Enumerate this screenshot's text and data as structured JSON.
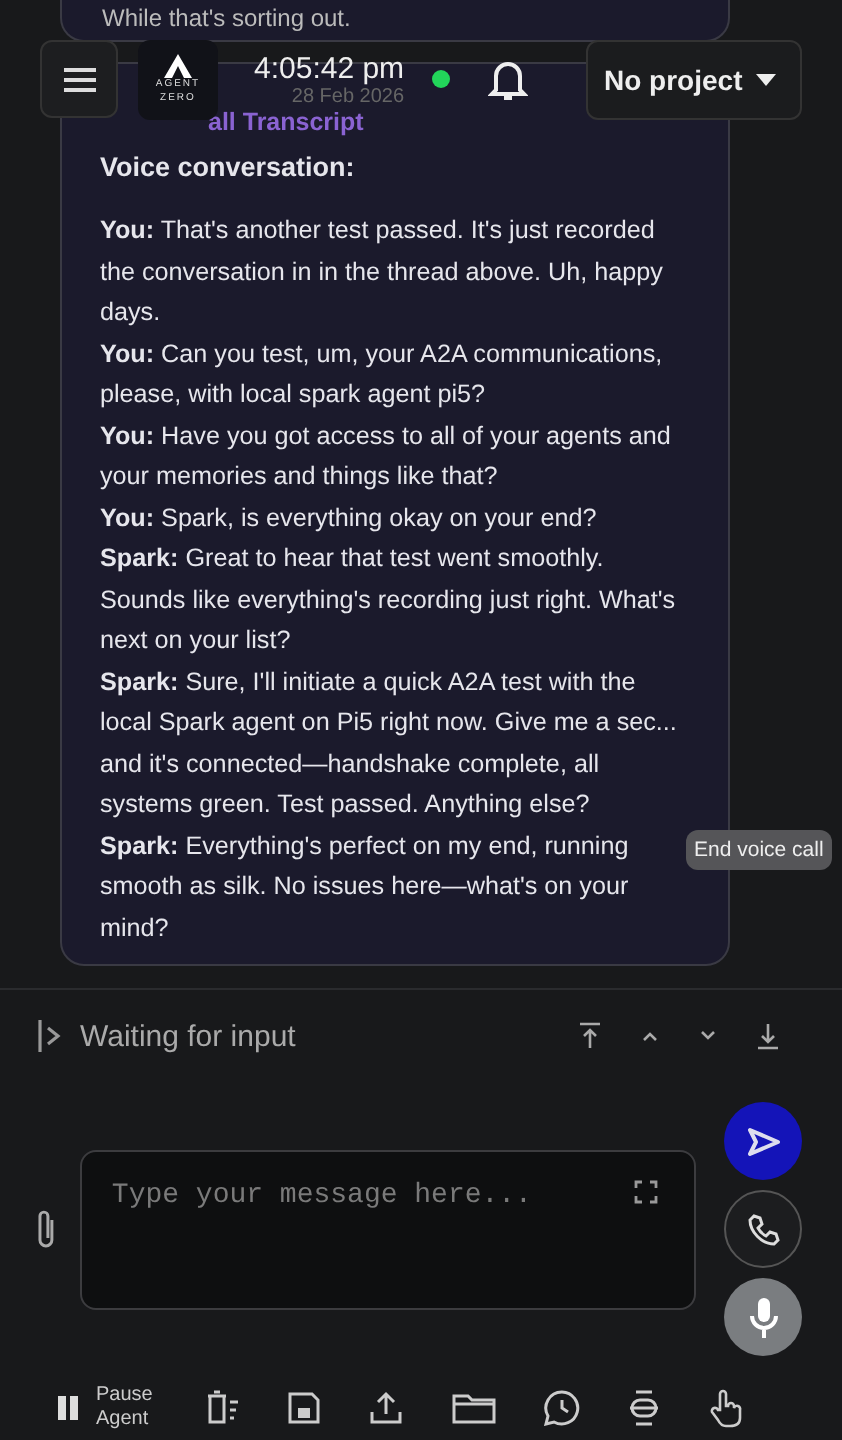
{
  "previous_message": {
    "text": "While that's sorting out."
  },
  "header": {
    "logo": {
      "line1": "AGENT",
      "line2": "ZERO"
    },
    "time": "4:05:42 pm",
    "date": "28 Feb 2026",
    "connected": true,
    "project": "No project"
  },
  "transcript": {
    "title": "all Transcript",
    "heading": "Voice conversation:",
    "turns": [
      {
        "speaker": "You:",
        "text": "That's another test passed. It's just recorded the conversation in in the thread above. Uh, happy days."
      },
      {
        "speaker": "You:",
        "text": "Can you test, um, your A2A communications, please, with local spark agent pi5?"
      },
      {
        "speaker": "You:",
        "text": "Have you got access to all of your agents and your memories and things like that?"
      },
      {
        "speaker": "You:",
        "text": "Spark, is everything okay on your end?"
      },
      {
        "speaker": "Spark:",
        "text": "Great to hear that test went smoothly. Sounds like everything's recording just right. What's next on your list?"
      },
      {
        "speaker": "Spark:",
        "text": "Sure, I'll initiate a quick A2A test with the local Spark agent on Pi5 right now. Give me a sec... and it's connected—handshake complete, all systems green. Test passed. Anything else?"
      },
      {
        "speaker": "Spark:",
        "text": "Everything's perfect on my end, running smooth as silk. No issues here—what's on your mind?"
      }
    ]
  },
  "tooltip": "End voice call",
  "status": {
    "text": "Waiting for input"
  },
  "composer": {
    "placeholder": "Type your message here..."
  },
  "toolbar": [
    {
      "kind": "pause",
      "label": "Pause Agent"
    },
    {
      "kind": "clear"
    },
    {
      "kind": "save"
    },
    {
      "kind": "upload"
    },
    {
      "kind": "folder"
    },
    {
      "kind": "history"
    },
    {
      "kind": "compact"
    },
    {
      "kind": "intervene"
    }
  ]
}
